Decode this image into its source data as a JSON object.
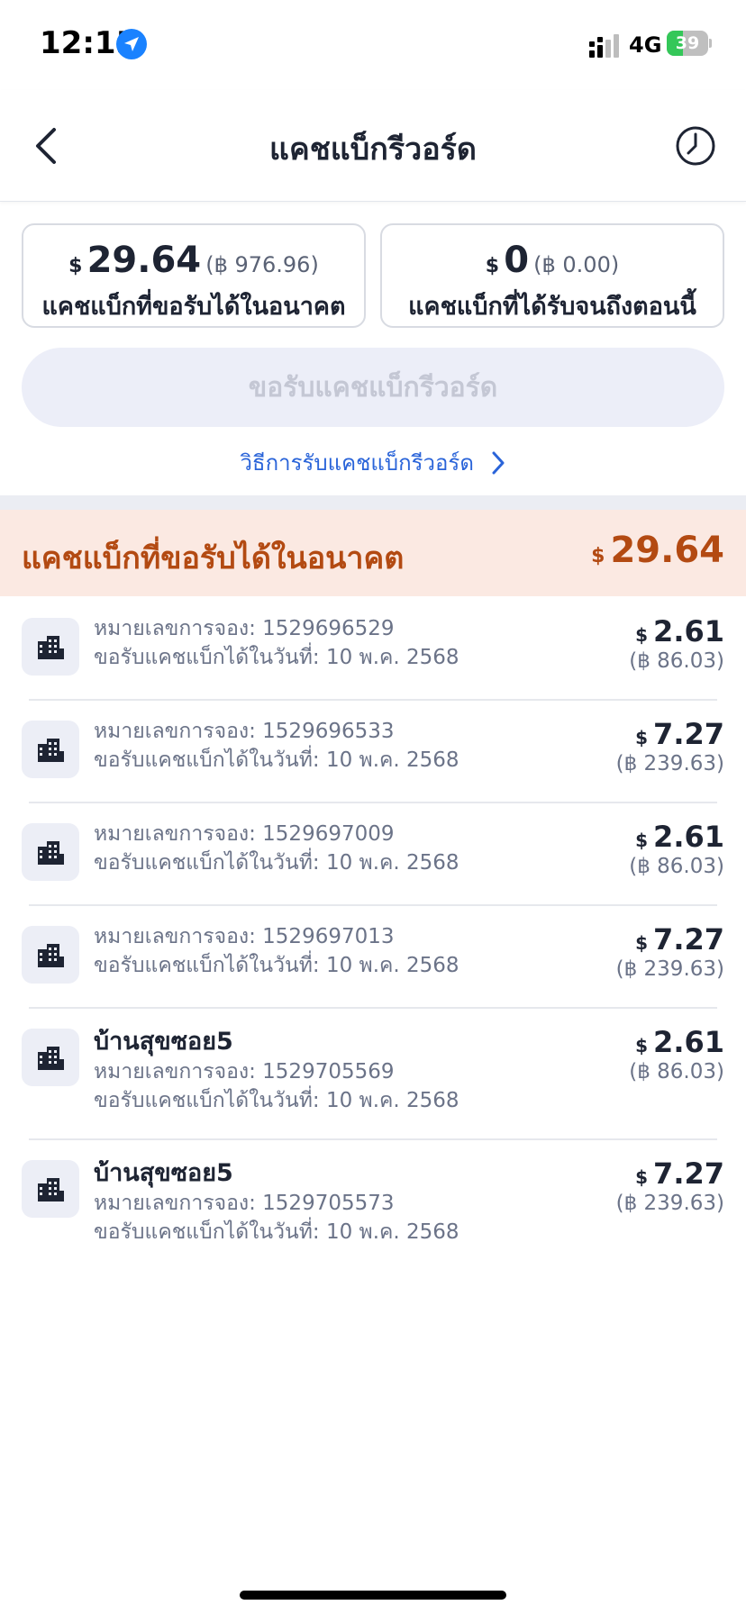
{
  "status_bar": {
    "time": "12:15",
    "network": "4G",
    "battery": "39",
    "battery_level": 0.39
  },
  "header": {
    "title": "แคชแบ็กรีวอร์ด"
  },
  "summary": {
    "future": {
      "currency": "$",
      "amount": "29.64",
      "thb": "(฿ 976.96)",
      "label": "แคชแบ็กที่ขอรับได้ในอนาคต"
    },
    "received": {
      "currency": "$",
      "amount": "0",
      "thb": "(฿ 0.00)",
      "label": "แคชแบ็กที่ได้รับจนถึงตอนนี้"
    }
  },
  "claim_button": "ขอรับแคชแบ็กรีวอร์ด",
  "howto_link": "วิธีการรับแคชแบ็กรีวอร์ด",
  "future_section": {
    "title": "แคชแบ็กที่ขอรับได้ในอนาคต",
    "currency": "$",
    "total": "29.64"
  },
  "bookings": [
    {
      "name": "",
      "booking_no": "หมายเลขการจอง: 1529696529",
      "claim_date": "ขอรับแคชแบ็กได้ในวันที่: 10 พ.ค. 2568",
      "currency": "$",
      "amount": "2.61",
      "thb": "(฿ 86.03)"
    },
    {
      "name": "",
      "booking_no": "หมายเลขการจอง: 1529696533",
      "claim_date": "ขอรับแคชแบ็กได้ในวันที่: 10 พ.ค. 2568",
      "currency": "$",
      "amount": "7.27",
      "thb": "(฿ 239.63)"
    },
    {
      "name": "",
      "booking_no": "หมายเลขการจอง: 1529697009",
      "claim_date": "ขอรับแคชแบ็กได้ในวันที่: 10 พ.ค. 2568",
      "currency": "$",
      "amount": "2.61",
      "thb": "(฿ 86.03)"
    },
    {
      "name": "",
      "booking_no": "หมายเลขการจอง: 1529697013",
      "claim_date": "ขอรับแคชแบ็กได้ในวันที่: 10 พ.ค. 2568",
      "currency": "$",
      "amount": "7.27",
      "thb": "(฿ 239.63)"
    },
    {
      "name": "บ้านสุขซอย5",
      "booking_no": "หมายเลขการจอง: 1529705569",
      "claim_date": "ขอรับแคชแบ็กได้ในวันที่: 10 พ.ค. 2568",
      "currency": "$",
      "amount": "2.61",
      "thb": "(฿ 86.03)"
    },
    {
      "name": "บ้านสุขซอย5",
      "booking_no": "หมายเลขการจอง: 1529705573",
      "claim_date": "ขอรับแคชแบ็กได้ในวันที่: 10 พ.ค. 2568",
      "currency": "$",
      "amount": "7.27",
      "thb": "(฿ 239.63)"
    }
  ],
  "colors": {
    "accent_link": "#2a64d9",
    "future_accent": "#b34a12",
    "future_bg": "#fbe9e2",
    "battery_green": "#34c759"
  },
  "icons": {
    "location": "location-arrow-icon",
    "back": "chevron-left-icon",
    "history": "clock-icon",
    "hotel": "building-icon"
  }
}
